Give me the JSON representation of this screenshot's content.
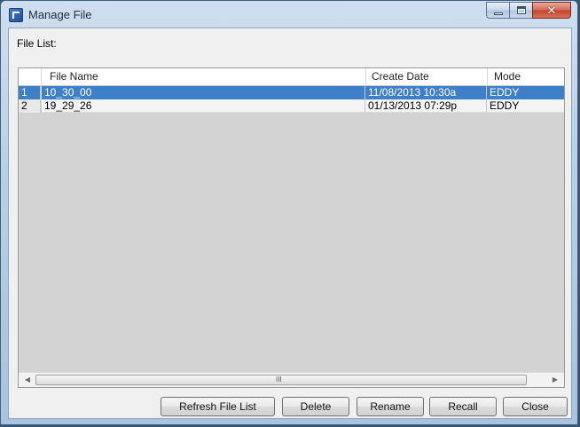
{
  "window": {
    "title": "Manage File"
  },
  "labels": {
    "file_list": "File List:"
  },
  "table": {
    "columns": [
      "File Name",
      "Create Date",
      "Mode"
    ],
    "rows": [
      {
        "num": "1",
        "name": "10_30_00",
        "date": "11/08/2013 10:30a",
        "mode": "EDDY",
        "selected": true
      },
      {
        "num": "2",
        "name": "19_29_26",
        "date": "01/13/2013 07:29p",
        "mode": "EDDY",
        "selected": false
      }
    ]
  },
  "scrollbar": {
    "grip": "III"
  },
  "buttons": {
    "refresh": "Refresh File List",
    "delete": "Delete",
    "rename": "Rename",
    "recall": "Recall",
    "close": "Close"
  },
  "colors": {
    "selection": "#3d7fc9",
    "grid_background": "#d3d3d3"
  }
}
